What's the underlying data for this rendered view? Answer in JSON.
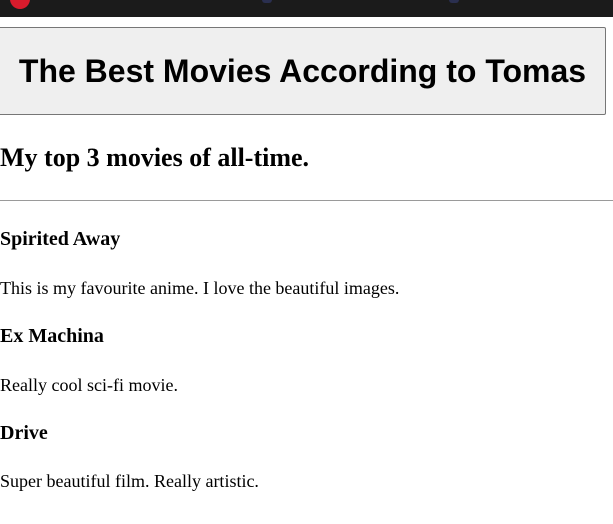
{
  "header": {
    "title_button_label": "The Best Movies According to Tomas",
    "subtitle": "My top 3 movies of all-time."
  },
  "movies": [
    {
      "title": "Spirited Away",
      "description": "This is my favourite anime. I love the beautiful images."
    },
    {
      "title": "Ex Machina",
      "description": "Really cool sci-fi movie."
    },
    {
      "title": "Drive",
      "description": "Super beautiful film. Really artistic."
    }
  ],
  "colors": {
    "top_strip": "#1b1b1b",
    "button_background": "#efefef",
    "button_border": "#767676",
    "divider": "#9a9a9a",
    "text": "#000000"
  }
}
